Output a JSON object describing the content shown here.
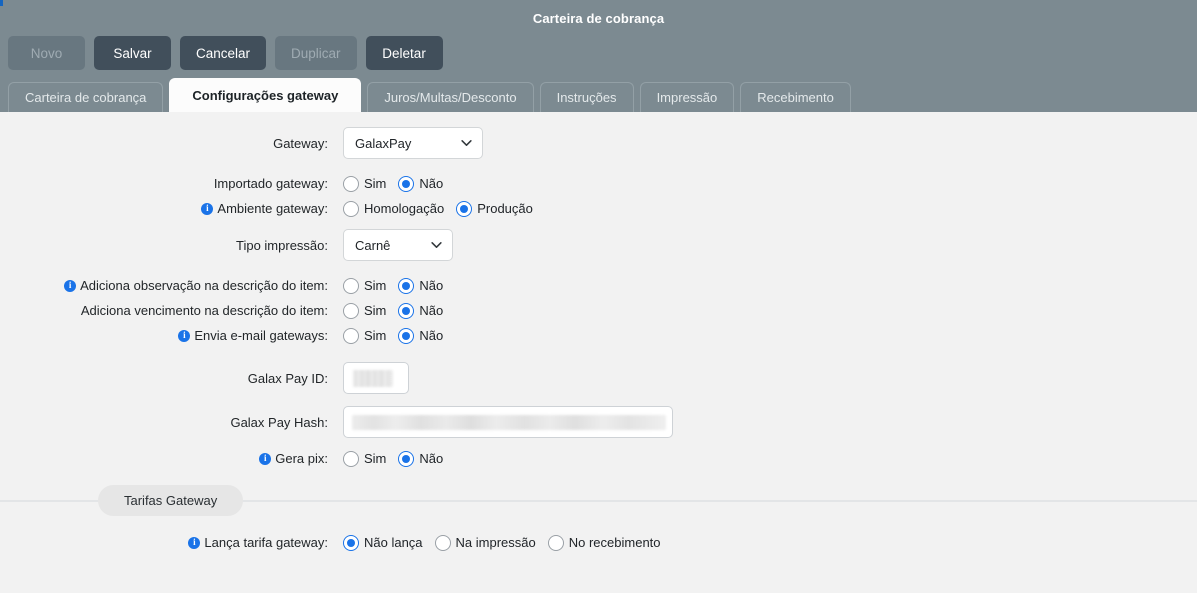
{
  "window": {
    "title": "Carteira de cobrança"
  },
  "toolbar": {
    "buttons": [
      {
        "label": "Novo",
        "disabled": true
      },
      {
        "label": "Salvar",
        "disabled": false
      },
      {
        "label": "Cancelar",
        "disabled": false
      },
      {
        "label": "Duplicar",
        "disabled": true
      },
      {
        "label": "Deletar",
        "disabled": false
      }
    ]
  },
  "tabs": [
    {
      "label": "Carteira de cobrança",
      "active": false
    },
    {
      "label": "Configurações gateway",
      "active": true
    },
    {
      "label": "Juros/Multas/Desconto",
      "active": false
    },
    {
      "label": "Instruções",
      "active": false
    },
    {
      "label": "Impressão",
      "active": false
    },
    {
      "label": "Recebimento",
      "active": false
    }
  ],
  "form": {
    "gateway": {
      "label": "Gateway:",
      "value": "GalaxPay",
      "options": [
        "GalaxPay"
      ]
    },
    "importado_gateway": {
      "label": "Importado gateway:",
      "options": [
        "Sim",
        "Não"
      ],
      "selected": "Não"
    },
    "ambiente_gateway": {
      "label": "Ambiente gateway:",
      "has_info": true,
      "options": [
        "Homologação",
        "Produção"
      ],
      "selected": "Produção"
    },
    "tipo_impressao": {
      "label": "Tipo impressão:",
      "value": "Carnê",
      "options": [
        "Carnê"
      ]
    },
    "adiciona_observacao": {
      "label": "Adiciona observação na descrição do item:",
      "has_info": true,
      "options": [
        "Sim",
        "Não"
      ],
      "selected": "Não"
    },
    "adiciona_vencimento": {
      "label": "Adiciona vencimento na descrição do item:",
      "has_info": false,
      "options": [
        "Sim",
        "Não"
      ],
      "selected": "Não"
    },
    "envia_email": {
      "label": "Envia e-mail gateways:",
      "has_info": true,
      "options": [
        "Sim",
        "Não"
      ],
      "selected": "Não"
    },
    "galax_pay_id": {
      "label": "Galax Pay ID:",
      "value": "",
      "redacted": true
    },
    "galax_pay_hash": {
      "label": "Galax Pay Hash:",
      "value": "",
      "redacted": true
    },
    "gera_pix": {
      "label": "Gera pix:",
      "has_info": true,
      "options": [
        "Sim",
        "Não"
      ],
      "selected": "Não"
    }
  },
  "section_tarifas": {
    "title": "Tarifas Gateway",
    "lanca_tarifa": {
      "label": "Lança tarifa gateway:",
      "has_info": true,
      "options": [
        "Não lança",
        "Na impressão",
        "No recebimento"
      ],
      "selected": "Não lança"
    }
  },
  "icons": {
    "info": "i",
    "chevron_down": "chevron-down-icon"
  },
  "colors": {
    "header_bg": "#7c8a91",
    "button_bg": "#414f5b",
    "button_disabled_bg": "#687780",
    "accent_blue": "#1a73e8",
    "page_bg": "#f2f2f2"
  }
}
